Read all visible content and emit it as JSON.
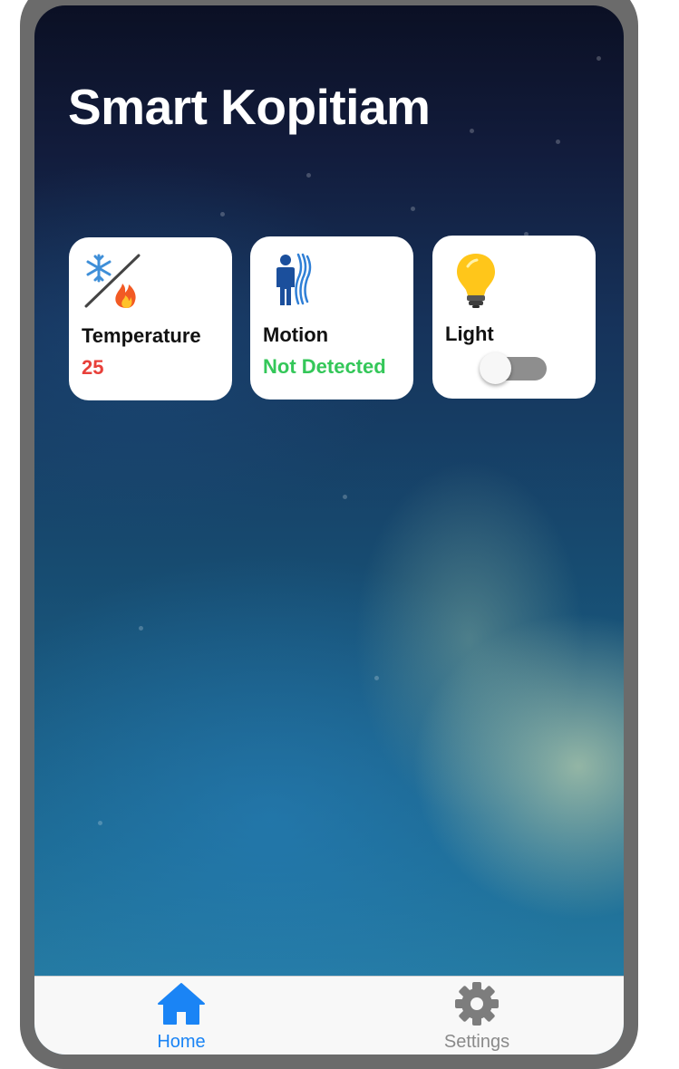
{
  "app": {
    "title": "Smart Kopitiam"
  },
  "cards": [
    {
      "label": "Temperature",
      "value": "25",
      "value_color": "#e8403a",
      "icon": "snowflake-fire-icon"
    },
    {
      "label": "Motion",
      "value": "Not Detected",
      "value_color": "#34c759",
      "icon": "person-motion-icon"
    },
    {
      "label": "Light",
      "icon": "light-bulb-icon",
      "toggle_on": false
    }
  ],
  "tabbar": {
    "home_label": "Home",
    "settings_label": "Settings",
    "active_color": "#1a84f5",
    "inactive_color": "#8a8a8a",
    "active_tab": "Home"
  }
}
